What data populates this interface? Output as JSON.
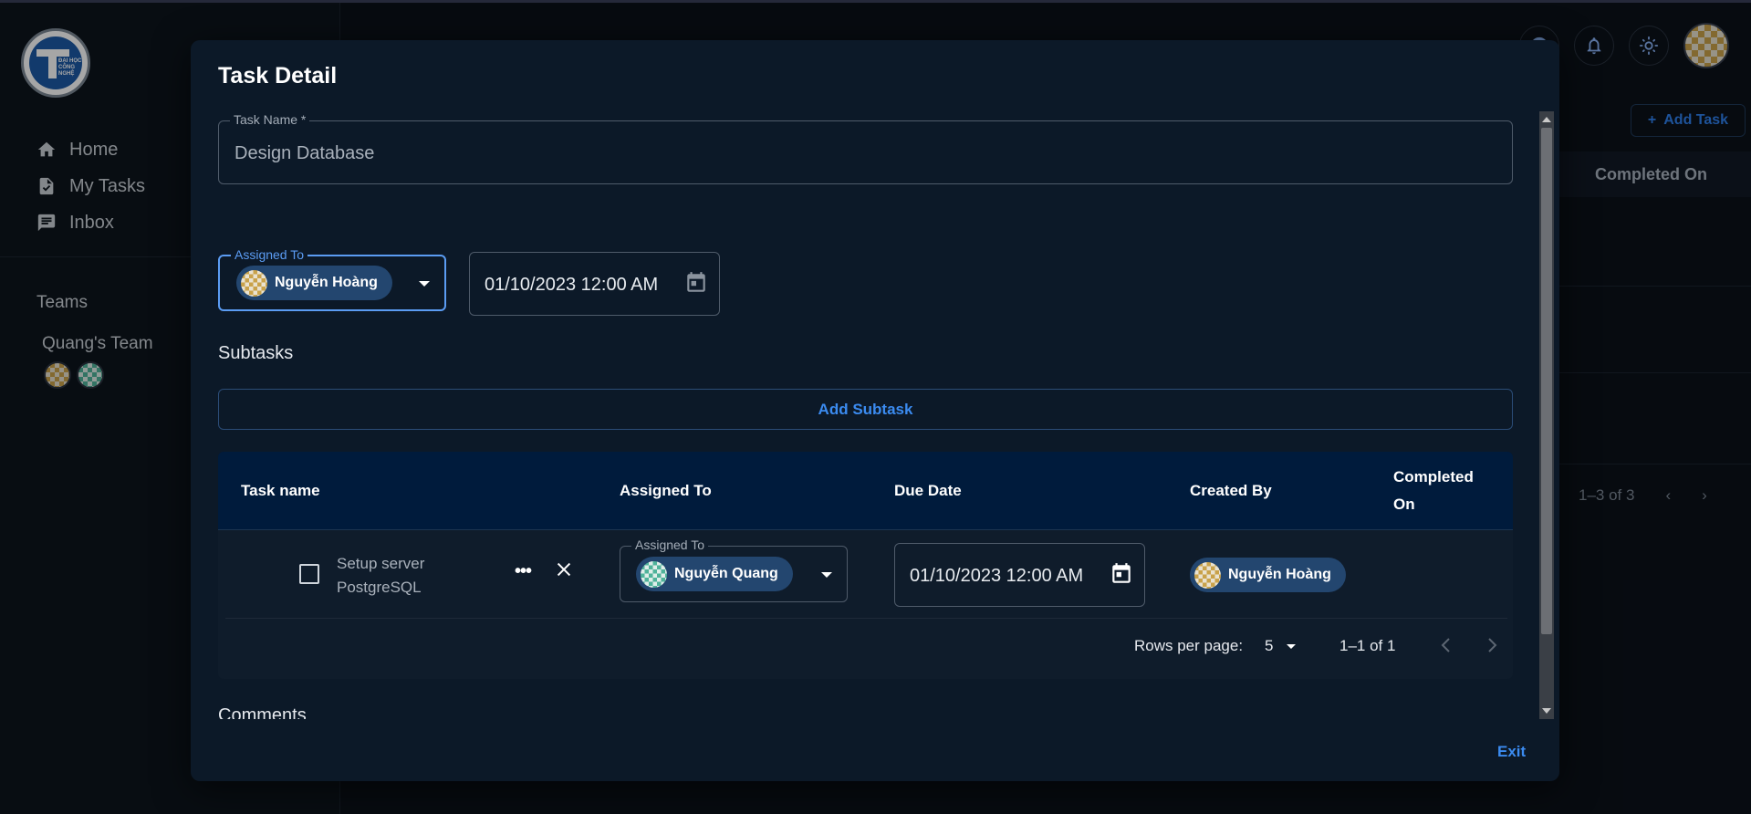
{
  "sidebar": {
    "nav": [
      {
        "label": "Home",
        "icon": "home-icon"
      },
      {
        "label": "My Tasks",
        "icon": "task-icon"
      },
      {
        "label": "Inbox",
        "icon": "inbox-icon"
      }
    ],
    "teams_label": "Teams",
    "team_name": "Quang's Team"
  },
  "background": {
    "add_task_label": "Add Task",
    "column_completed_on": "Completed On",
    "pagination_range": "1–3 of 3"
  },
  "modal": {
    "title": "Task Detail",
    "task_name": {
      "legend": "Task Name *",
      "value": "Design Database"
    },
    "assigned_to": {
      "legend": "Assigned To",
      "name": "Nguyễn Hoàng"
    },
    "due_date": "01/10/2023 12:00 AM",
    "subtasks_label": "Subtasks",
    "add_subtask_label": "Add Subtask",
    "table": {
      "headers": {
        "task_name": "Task name",
        "assigned_to": "Assigned To",
        "due_date": "Due Date",
        "created_by": "Created By",
        "completed_on_line1": "Completed",
        "completed_on_line2": "On"
      },
      "rows": [
        {
          "name_line1": "Setup server",
          "name_line2": "PostgreSQL",
          "assigned_legend": "Assigned To",
          "assigned_name": "Nguyễn Quang",
          "due_date": "01/10/2023 12:00 AM",
          "created_by": "Nguyễn Hoàng",
          "completed_on": ""
        }
      ],
      "pagination": {
        "rows_per_page_label": "Rows per page:",
        "rows_per_page": "5",
        "range": "1–1 of 1"
      }
    },
    "comments_label": "Comments",
    "exit_label": "Exit"
  },
  "colors": {
    "accent": "#3b8bf0",
    "chip": "#23466f",
    "modal_bg": "#0c1928",
    "table_header": "#001b3c"
  }
}
